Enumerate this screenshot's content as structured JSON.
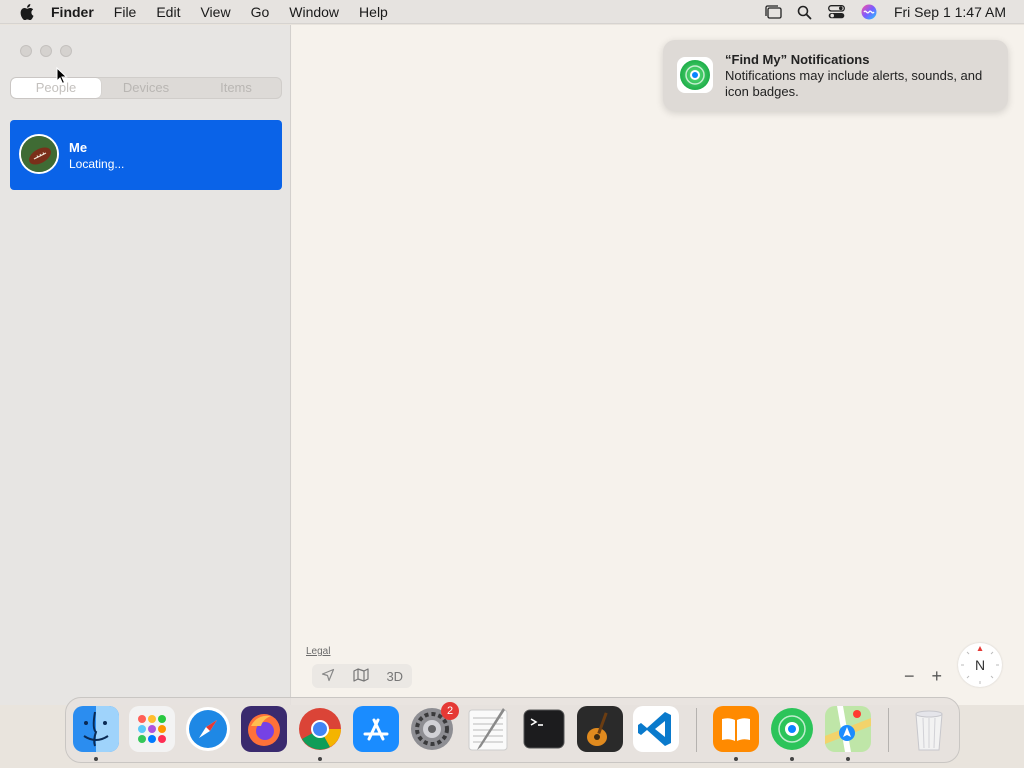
{
  "menubar": {
    "app_name": "Finder",
    "items": [
      "File",
      "Edit",
      "View",
      "Go",
      "Window",
      "Help"
    ],
    "clock": "Fri Sep 1  1:47 AM"
  },
  "sidebar": {
    "tabs": [
      {
        "label": "People",
        "active": true
      },
      {
        "label": "Devices",
        "active": false
      },
      {
        "label": "Items",
        "active": false
      }
    ],
    "people": [
      {
        "name": "Me",
        "status": "Locating..."
      }
    ]
  },
  "map": {
    "legal": "Legal",
    "view_3d": "3D",
    "zoom_out": "−",
    "zoom_in": "+",
    "compass": "N"
  },
  "notification": {
    "title": "“Find My” Notifications",
    "body": "Notifications may include alerts, sounds, and icon badges."
  },
  "dock": {
    "apps": [
      {
        "name": "Finder",
        "running": true
      },
      {
        "name": "Launchpad",
        "running": false
      },
      {
        "name": "Safari",
        "running": false
      },
      {
        "name": "Firefox",
        "running": false
      },
      {
        "name": "Chrome",
        "running": true
      },
      {
        "name": "App Store",
        "running": false
      },
      {
        "name": "System Settings",
        "running": false,
        "badge": "2"
      },
      {
        "name": "TextEdit",
        "running": false
      },
      {
        "name": "Terminal",
        "running": false
      },
      {
        "name": "GarageBand",
        "running": false
      },
      {
        "name": "Visual Studio Code",
        "running": false
      },
      {
        "name": "Books",
        "running": true
      },
      {
        "name": "Find My",
        "running": true
      },
      {
        "name": "Maps",
        "running": true
      },
      {
        "name": "Trash",
        "running": false
      }
    ]
  },
  "colors": {
    "selection_blue": "#0a63e8",
    "find_my_green": "#34c759",
    "badge_red": "#e53935"
  }
}
